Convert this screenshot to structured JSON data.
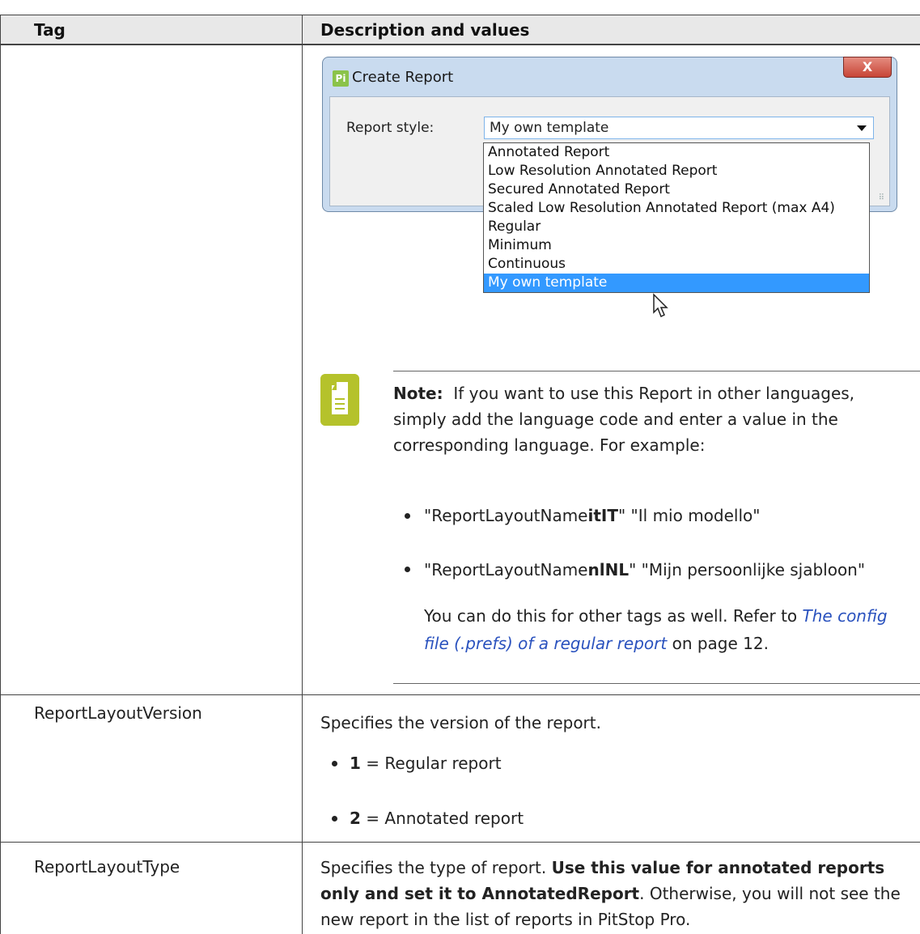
{
  "table": {
    "header_tag": "Tag",
    "header_description": "Description and values"
  },
  "dialog": {
    "title": "Create Report",
    "close_label": "X",
    "app_icon_label": "Pi",
    "report_style_label": "Report style:",
    "selected_value": "My own template",
    "options": [
      "Annotated Report",
      "Low Resolution Annotated Report",
      "Secured Annotated Report",
      "Scaled Low Resolution Annotated Report (max A4)",
      "Regular",
      "Minimum",
      "Continuous",
      "My own template"
    ]
  },
  "note": {
    "label": "Note:",
    "text": "If you want to use this Report in other languages, simply add the language code and enter a value in the corresponding language. For example:",
    "bullet1_prefix": "\"ReportLayoutName",
    "bullet1_bold": "itIT",
    "bullet1_suffix": "\" \"Il mio modello\"",
    "bullet2_prefix": "\"ReportLayoutName",
    "bullet2_bold": "nlNL",
    "bullet2_suffix": "\" \"Mijn persoonlijke sjabloon\"",
    "tail_prefix": "You can do this for other tags as well. Refer to ",
    "tail_link": "The config file (.prefs) of a regular report",
    "tail_suffix": " on page 12."
  },
  "rows": {
    "version": {
      "tag": "ReportLayoutVersion",
      "description": "Specifies the version of the report.",
      "item1_value": "1",
      "item1_text": " = Regular report",
      "item2_value": "2",
      "item2_text": " = Annotated report"
    },
    "type": {
      "tag": "ReportLayoutType",
      "description_prefix": "Specifies the type of report. ",
      "description_bold": "Use this value for annotated reports only and set it to AnnotatedReport",
      "description_suffix": ". Otherwise, you will not see the new report in the list of reports in PitStop Pro."
    }
  }
}
